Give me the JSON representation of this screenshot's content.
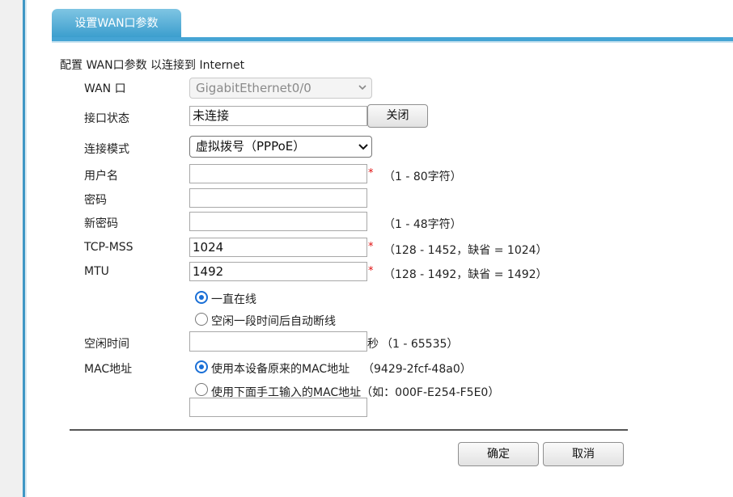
{
  "tab": {
    "title": "设置WAN口参数"
  },
  "description": "配置 WAN口参数 以连接到 Internet",
  "wan_port": {
    "label": "WAN 口",
    "selected": "GigabitEthernet0/0"
  },
  "interface_status": {
    "label": "接口状态",
    "value": "未连接",
    "button": "关闭"
  },
  "connection_mode": {
    "label": "连接模式",
    "selected": "虚拟拨号（PPPoE）"
  },
  "username": {
    "label": "用户名",
    "value": "",
    "required_mark": "*",
    "hint": "（1 - 80字符）"
  },
  "password": {
    "label": "密码",
    "value": ""
  },
  "new_password": {
    "label": "新密码",
    "value": "",
    "hint": "（1 - 48字符）"
  },
  "tcp_mss": {
    "label": "TCP-MSS",
    "value": "1024",
    "required_mark": "*",
    "hint": "（128 - 1452，缺省 = 1024）"
  },
  "mtu": {
    "label": "MTU",
    "value": "1492",
    "required_mark": "*",
    "hint": "（128 - 1492，缺省 = 1492）"
  },
  "online_mode": {
    "always_online": {
      "label": "一直在线",
      "checked": true
    },
    "idle_disconnect": {
      "label": "空闲一段时间后自动断线",
      "checked": false
    }
  },
  "idle_time": {
    "label": "空闲时间",
    "value": "",
    "unit": "秒",
    "hint": "（1 - 65535）"
  },
  "mac_address": {
    "label": "MAC地址",
    "use_original": {
      "label": "使用本设备原来的MAC地址",
      "value": "（9429-2fcf-48a0）",
      "checked": true
    },
    "use_manual": {
      "label": "使用下面手工输入的MAC地址（如：000F-E254-F5E0）",
      "checked": false
    },
    "manual_value": ""
  },
  "footer": {
    "confirm": "确定",
    "cancel": "取消"
  },
  "colors": {
    "accent": "#3a9dcd",
    "radio": "#1a6fd6",
    "required": "#e01010"
  }
}
